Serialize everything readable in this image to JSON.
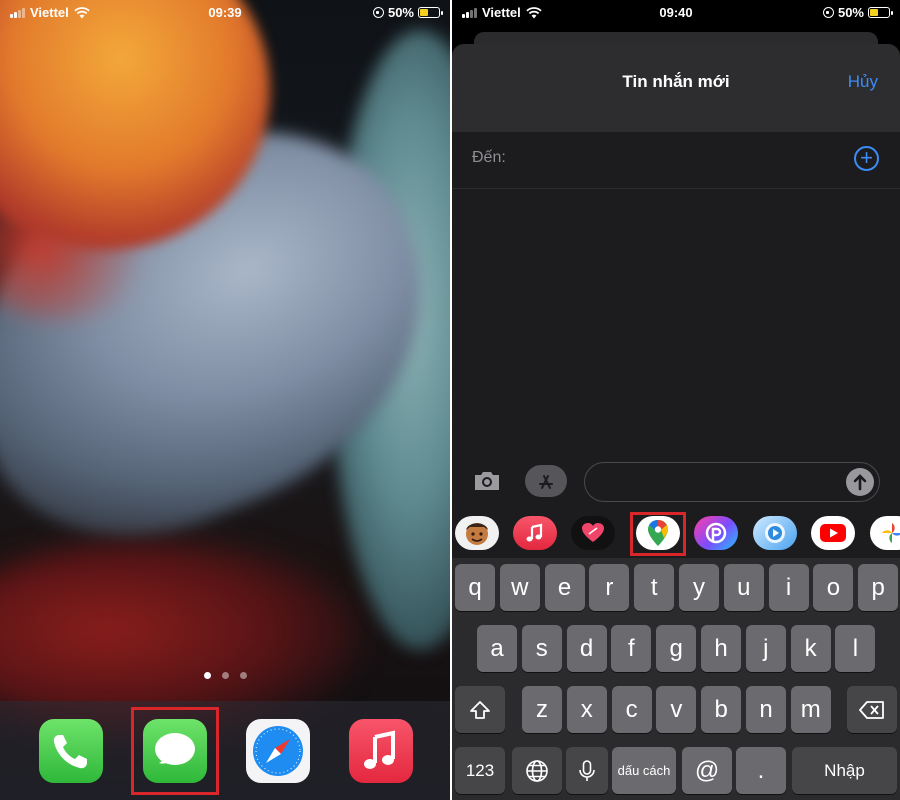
{
  "left_screen": {
    "status": {
      "carrier": "Viettel",
      "time": "09:39",
      "battery": "50%"
    },
    "page_dots": 3,
    "dock": [
      {
        "name": "Phone",
        "icon": "phone-icon"
      },
      {
        "name": "Messages",
        "icon": "messages-icon",
        "highlighted": true
      },
      {
        "name": "Safari",
        "icon": "safari-icon"
      },
      {
        "name": "Music",
        "icon": "music-icon"
      }
    ]
  },
  "right_screen": {
    "status": {
      "carrier": "Viettel",
      "time": "09:40",
      "battery": "50%"
    },
    "header": {
      "title": "Tin nhắn mới",
      "cancel": "Hủy"
    },
    "to_label": "Đến:",
    "message_input": {
      "value": "",
      "placeholder": ""
    },
    "app_strip": [
      "memoji-icon",
      "music-icon",
      "digital-touch-icon",
      "google-maps-icon",
      "picsart-icon",
      "app-icon",
      "youtube-icon",
      "google-photos-icon"
    ],
    "highlighted_app": "google-maps-icon",
    "keyboard": {
      "row1": [
        "q",
        "w",
        "e",
        "r",
        "t",
        "y",
        "u",
        "i",
        "o",
        "p"
      ],
      "row2": [
        "a",
        "s",
        "d",
        "f",
        "g",
        "h",
        "j",
        "k",
        "l"
      ],
      "row3": [
        "z",
        "x",
        "c",
        "v",
        "b",
        "n",
        "m"
      ],
      "numbers_key": "123",
      "space_key": "dấu cách",
      "at_key": "@",
      "dot_key": ".",
      "return_key": "Nhập"
    }
  },
  "colors": {
    "accent": "#3b8bf5",
    "highlight": "#d9262b",
    "messages_green": "#34c759"
  }
}
